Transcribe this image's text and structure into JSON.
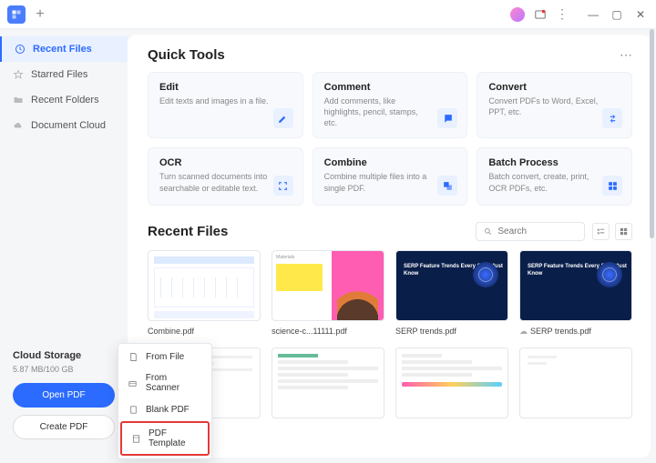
{
  "titlebar": {
    "plus": "+"
  },
  "sidebar": {
    "items": [
      {
        "label": "Recent Files"
      },
      {
        "label": "Starred Files"
      },
      {
        "label": "Recent Folders"
      },
      {
        "label": "Document Cloud"
      }
    ]
  },
  "cloud": {
    "title": "Cloud Storage",
    "usage": "5.87 MB/100 GB",
    "open_label": "Open PDF",
    "create_label": "Create PDF"
  },
  "sections": {
    "quick_tools": "Quick Tools",
    "recent_files": "Recent Files"
  },
  "tools": [
    {
      "name": "Edit",
      "desc": "Edit texts and images in a file."
    },
    {
      "name": "Comment",
      "desc": "Add comments, like highlights, pencil, stamps, etc."
    },
    {
      "name": "Convert",
      "desc": "Convert PDFs to Word, Excel, PPT, etc."
    },
    {
      "name": "OCR",
      "desc": "Turn scanned documents into searchable or editable text."
    },
    {
      "name": "Combine",
      "desc": "Combine multiple files into a single PDF."
    },
    {
      "name": "Batch Process",
      "desc": "Batch convert, create, print, OCR PDFs, etc."
    }
  ],
  "search": {
    "placeholder": "Search"
  },
  "files": [
    {
      "name": "Combine.pdf"
    },
    {
      "name": "science-c...11111.pdf"
    },
    {
      "name": "SERP trends.pdf"
    },
    {
      "name": "SERP trends.pdf",
      "cloud": true
    }
  ],
  "serp_text": "SERP Feature\nTrends Every\nSEO Must Know",
  "ctx": {
    "items": [
      {
        "label": "From File"
      },
      {
        "label": "From Scanner"
      },
      {
        "label": "Blank PDF"
      },
      {
        "label": "PDF Template"
      }
    ]
  }
}
